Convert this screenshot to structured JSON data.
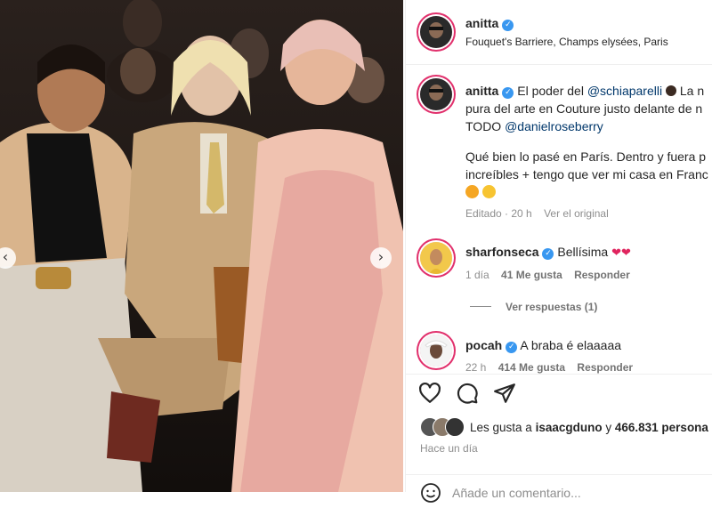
{
  "post": {
    "username": "anitta",
    "location": "Fouquet's Barriere, Champs elysées, Paris"
  },
  "caption": {
    "username": "anitta",
    "line1_text": "El poder del",
    "line1_mention": "@schiaparelli",
    "line1_rest": "La n",
    "line2": "pura del arte en Couture justo delante de n",
    "line3_prefix": "TODO",
    "line3_mention": "@danielroseberry",
    "line4": "Qué bien lo pasé en París. Dentro y fuera p",
    "line5": "increíbles + tengo que ver mi casa en Franc",
    "edited": "Editado · 20 h",
    "translate": "Ver el original"
  },
  "comments": [
    {
      "username": "sharfonseca",
      "text": "Bellísima",
      "time": "1 día",
      "likes": "41 Me gusta",
      "reply": "Responder",
      "view_replies": "Ver respuestas (1)"
    },
    {
      "username": "pocah",
      "text": "A braba é elaaaaa",
      "time": "22 h",
      "likes": "414 Me gusta",
      "reply": "Responder"
    }
  ],
  "likes": {
    "prefix": "Les gusta a",
    "user": "isaacgduno",
    "conj": "y",
    "count": "466.831 persona"
  },
  "timestamp": "Hace un día",
  "comment_placeholder": "Añade un comentario...",
  "icons": {
    "like": "heart-icon",
    "comment": "comment-icon",
    "share": "share-icon",
    "verified": "verified-badge-icon",
    "prev": "chevron-left-icon",
    "next": "chevron-right-icon",
    "emoji": "emoji-icon"
  },
  "colors": {
    "link": "#00376b",
    "meta": "#8e8e8e",
    "verified": "#3897f0",
    "heart": "#e0245e"
  }
}
